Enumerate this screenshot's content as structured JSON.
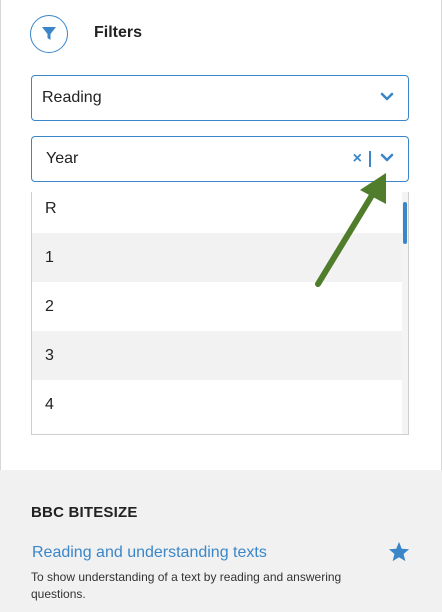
{
  "filters": {
    "title": "Filters",
    "icon": "filter-icon"
  },
  "subject_select": {
    "value": "Reading"
  },
  "year_select": {
    "value": "Year",
    "clear_symbol": "×",
    "options": [
      "R",
      "1",
      "2",
      "3",
      "4"
    ]
  },
  "result_card": {
    "brand": "BBC BITESIZE",
    "title": "Reading and understanding texts",
    "description": "To show understanding of a text by reading and answering questions."
  },
  "colors": {
    "accent": "#3a86c8",
    "annotation_arrow": "#4f7d2b"
  }
}
